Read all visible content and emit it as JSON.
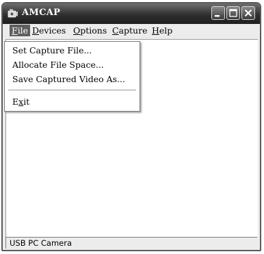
{
  "window": {
    "title": "AMCAP",
    "app_icon": "camera-icon",
    "controls": [
      "minimize-icon",
      "maximize-icon",
      "close-icon"
    ]
  },
  "menubar": {
    "items": [
      {
        "label_u": "F",
        "label_rest": "ile",
        "active": true
      },
      {
        "label_u": "D",
        "label_rest": "evices",
        "active": false
      },
      {
        "label_u": "O",
        "label_rest": "ptions",
        "active": false
      },
      {
        "label_u": "C",
        "label_rest": "apture",
        "active": false
      },
      {
        "label_u": "H",
        "label_rest": "elp",
        "active": false
      }
    ]
  },
  "file_menu": {
    "items": [
      {
        "label": "Set Capture File..."
      },
      {
        "label": "Allocate File Space..."
      },
      {
        "label": "Save Captured Video As..."
      },
      {
        "label_u": "x",
        "label_pre": "E",
        "label_rest": "it"
      }
    ]
  },
  "statusbar": {
    "text": "USB PC Camera"
  },
  "colors": {
    "titlebar": "#2f2f2f",
    "menu_highlight": "#5e5e5e",
    "window_bg": "#ececec"
  }
}
